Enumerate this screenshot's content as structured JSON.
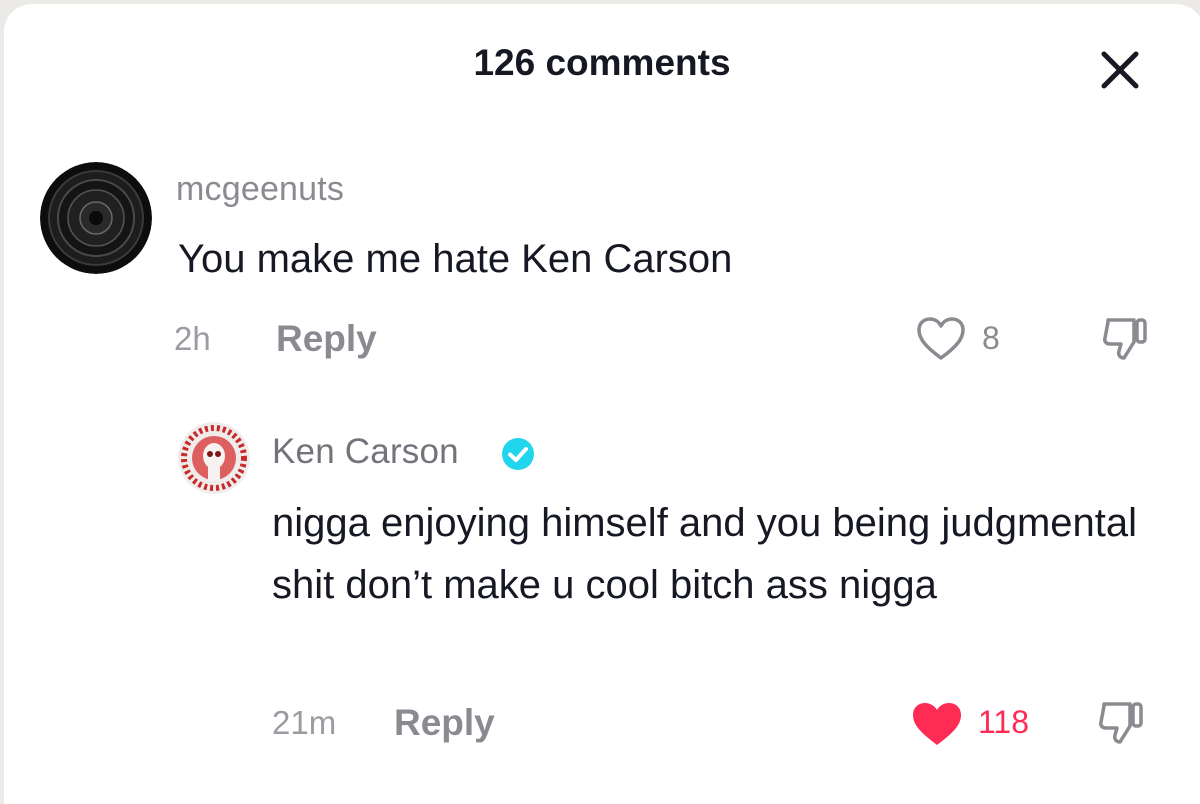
{
  "header": {
    "title": "126 comments",
    "close_icon": "close-icon"
  },
  "colors": {
    "text_primary": "#161823",
    "text_secondary": "#8a8b91",
    "like_active": "#fe2c55",
    "verified": "#20d5ec"
  },
  "comments": [
    {
      "username": "mcgeenuts",
      "text": "You make me hate Ken Carson",
      "time": "2h",
      "reply_label": "Reply",
      "likes": "8",
      "liked": false
    },
    {
      "username": "Ken Carson",
      "verified": true,
      "text": "nigga enjoying himself and you being judgmental shit don’t make u cool bitch ass nigga",
      "time": "21m",
      "reply_label": "Reply",
      "likes": "118",
      "liked": true
    }
  ]
}
